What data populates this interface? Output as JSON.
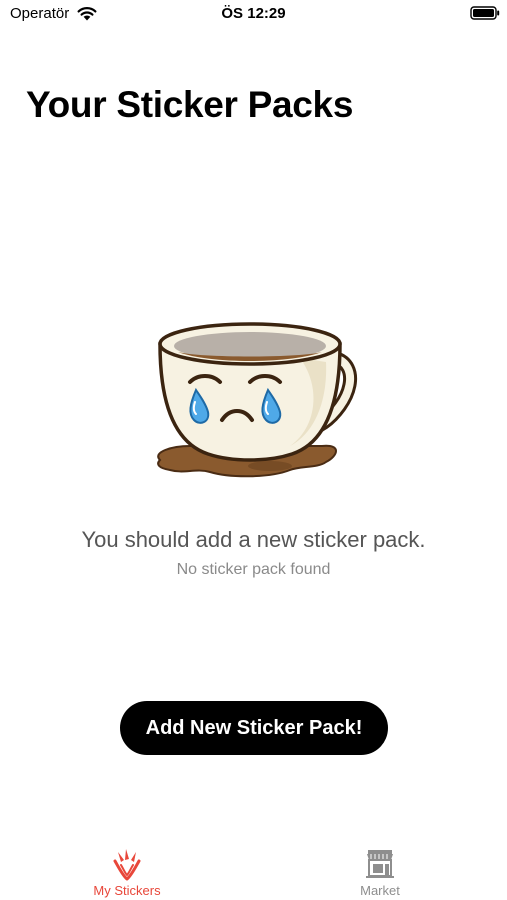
{
  "status_bar": {
    "carrier": "Operatör",
    "time": "ÖS 12:29",
    "icons": [
      "wifi-icon",
      "battery-icon"
    ]
  },
  "page": {
    "title": "Your Sticker Packs"
  },
  "empty_state": {
    "illustration": "crying-coffee-cup",
    "heading": "You should add a new sticker pack.",
    "subheading": "No sticker pack found"
  },
  "actions": {
    "add_pack_label": "Add New Sticker Pack!"
  },
  "tab_bar": {
    "tabs": [
      {
        "label": "My Stickers",
        "icon": "my-stickers-icon",
        "selected": true
      },
      {
        "label": "Market",
        "icon": "market-store-icon",
        "selected": false
      }
    ]
  },
  "colors": {
    "accent": "#e8473a",
    "button_background": "#000000",
    "button_text": "#ffffff",
    "inactive_tab": "#8e8e8e"
  }
}
